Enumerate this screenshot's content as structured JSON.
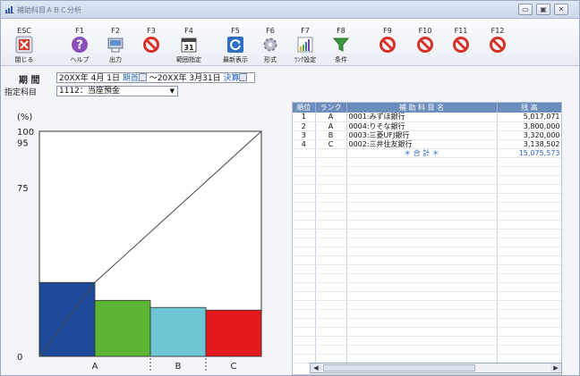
{
  "window": {
    "title": "補助科目ＡＢＣ分析",
    "buttons": [
      "minimize",
      "restore",
      "close"
    ]
  },
  "toolbar": {
    "items": [
      {
        "key": "ESC",
        "label": "閉じる",
        "icon": "close-x-icon"
      },
      {
        "key": "F1",
        "label": "ヘルプ",
        "icon": "help-icon"
      },
      {
        "key": "F2",
        "label": "出力",
        "icon": "printer-icon"
      },
      {
        "key": "F3",
        "label": "",
        "icon": "prohibited-icon"
      },
      {
        "key": "F4",
        "label": "範囲指定",
        "icon": "calendar-icon"
      },
      {
        "key": "F5",
        "label": "最新表示",
        "icon": "refresh-icon"
      },
      {
        "key": "F6",
        "label": "形式",
        "icon": "gear-icon"
      },
      {
        "key": "F7",
        "label": "ﾗﾝｸ設定",
        "icon": "bar-chart-icon"
      },
      {
        "key": "F8",
        "label": "条件",
        "icon": "funnel-icon"
      },
      {
        "key": "F9",
        "label": "",
        "icon": "prohibited-icon"
      },
      {
        "key": "F10",
        "label": "",
        "icon": "prohibited-icon"
      },
      {
        "key": "F11",
        "label": "",
        "icon": "prohibited-icon"
      },
      {
        "key": "F12",
        "label": "",
        "icon": "prohibited-icon"
      }
    ]
  },
  "filter": {
    "period_label": "期 間",
    "period_start": "20XX年 4月 1日",
    "period_start_tag": "期首",
    "period_range_sep": "～",
    "period_end": "20XX年 3月31日",
    "period_end_tag": "決算",
    "account_label": "指定科目",
    "account_value": "1112：当座預金"
  },
  "chart_data": {
    "type": "bar",
    "ylabel": "(%)",
    "yticks": [
      "100",
      "95",
      "75",
      "0"
    ],
    "ylim": [
      0,
      100
    ],
    "groups": [
      "A",
      "B",
      "C"
    ],
    "bars": [
      {
        "name": "0001:みずほ銀行",
        "rank": "A",
        "value": 5017071,
        "color": "#1d4a9b"
      },
      {
        "name": "0004:りそな銀行",
        "rank": "A",
        "value": 3800000,
        "color": "#5db534"
      },
      {
        "name": "0003:三菱UFJ銀行",
        "rank": "B",
        "value": 3320000,
        "color": "#6cc6d4"
      },
      {
        "name": "0002:三井住友銀行",
        "rank": "C",
        "value": 3138502,
        "color": "#e4191e"
      }
    ],
    "cumulative_line": true
  },
  "table": {
    "headers": [
      "順位",
      "ランク",
      "補 助 科 目 名",
      "残 高"
    ],
    "rows": [
      {
        "rank": "1",
        "class": "A",
        "name": "0001:みずほ銀行",
        "balance": "5,017,071"
      },
      {
        "rank": "2",
        "class": "A",
        "name": "0004:りそな銀行",
        "balance": "3,800,000"
      },
      {
        "rank": "3",
        "class": "B",
        "name": "0003:三菱UFJ銀行",
        "balance": "3,320,000"
      },
      {
        "rank": "4",
        "class": "C",
        "name": "0002:三井住友銀行",
        "balance": "3,138,502"
      }
    ],
    "total_label": "＊ 合 計 ＊",
    "total_value": "15,075,573"
  }
}
